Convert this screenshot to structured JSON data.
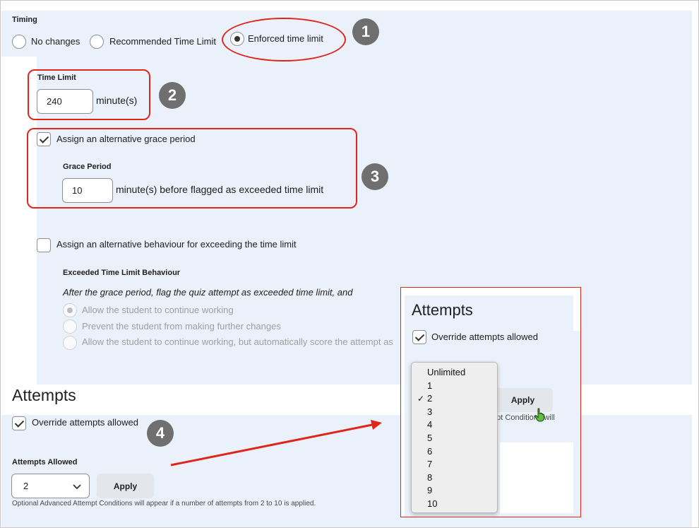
{
  "timing": {
    "label": "Timing",
    "options": [
      "No changes",
      "Recommended Time Limit",
      "Enforced time limit"
    ],
    "selected": "Enforced time limit"
  },
  "time_limit": {
    "label": "Time Limit",
    "value": "240",
    "unit": "minute(s)"
  },
  "grace": {
    "checkbox_label": "Assign an alternative grace period",
    "checked": true,
    "label": "Grace Period",
    "value": "10",
    "unit": "minute(s) before flagged as exceeded time limit"
  },
  "exceed": {
    "checkbox_label": "Assign an alternative behaviour for exceeding the time limit",
    "checked": false,
    "label": "Exceeded Time Limit Behaviour",
    "description": "After the grace period, flag the quiz attempt as exceeded time limit, and",
    "options": [
      "Allow the student to continue working",
      "Prevent the student from making further changes",
      "Allow the student to continue working, but automatically score the attempt as"
    ]
  },
  "attempts": {
    "heading": "Attempts",
    "override_label": "Override attempts allowed",
    "override_checked": true,
    "allowed_label": "Attempts Allowed",
    "selected_value": "2",
    "apply_label": "Apply",
    "help_text": "Optional Advanced Attempt Conditions will appear if a number of attempts from 2 to 10 is applied."
  },
  "zoom_panel": {
    "heading": "Attempts",
    "override_label": "Override attempts allowed",
    "apply_label": "Apply",
    "partial_text": "mpt Conditions will",
    "dropdown_options": [
      "Unlimited",
      "1",
      "2",
      "3",
      "4",
      "5",
      "6",
      "7",
      "8",
      "9",
      "10"
    ],
    "dropdown_selected": "2",
    "check_mark": "✓"
  },
  "badges": [
    "1",
    "2",
    "3",
    "4"
  ],
  "colors": {
    "annotation_red": "#e1251b",
    "panel_background": "#eaf1fa",
    "badge_gray": "#6f6f6f"
  }
}
